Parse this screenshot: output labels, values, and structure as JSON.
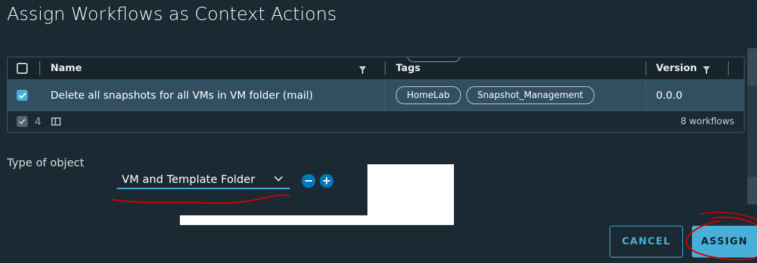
{
  "dialog": {
    "title": "Assign Workflows as Context Actions"
  },
  "grid": {
    "columns": {
      "name": "Name",
      "tags": "Tags",
      "version": "Version"
    },
    "rows": [
      {
        "selected": true,
        "name": "Delete all snapshots for all VMs in VM folder (mail)",
        "tags": [
          "HomeLab",
          "Snapshot_Management"
        ],
        "version": "0.0.0"
      }
    ],
    "footer": {
      "selected_count": "4",
      "total": "8 workflows"
    }
  },
  "form": {
    "type_label": "Type of object",
    "type_value": "VM and Template Folder"
  },
  "buttons": {
    "cancel": "CANCEL",
    "assign": "ASSIGN"
  },
  "colors": {
    "accent": "#49afd9",
    "background": "#1b2a32",
    "selected_row": "#324f61",
    "annotation": "#d00000"
  },
  "icons": [
    "filter-icon",
    "check-icon",
    "column-toggle-icon",
    "chevron-down-icon",
    "minus-icon",
    "plus-icon"
  ]
}
